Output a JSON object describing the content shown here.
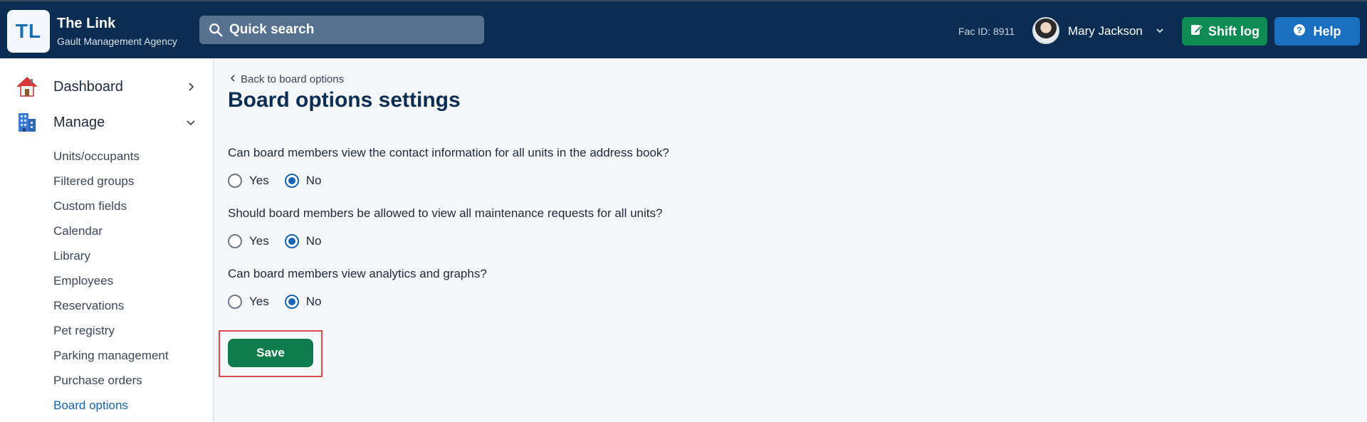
{
  "header": {
    "logo_text": "TL",
    "app_title": "The Link",
    "app_subtitle": "Gault Management Agency",
    "search_placeholder": "Quick search",
    "fac_id": "Fac ID: 8911",
    "user_name": "Mary Jackson",
    "shift_log_label": "Shift log",
    "help_label": "Help",
    "colors": {
      "bg": "#0b2d52",
      "shift": "#0e8a53",
      "help": "#1a6fc0"
    }
  },
  "sidebar": {
    "dashboard_label": "Dashboard",
    "manage_label": "Manage",
    "items": [
      {
        "label": "Units/occupants"
      },
      {
        "label": "Filtered groups"
      },
      {
        "label": "Custom fields"
      },
      {
        "label": "Calendar"
      },
      {
        "label": "Library"
      },
      {
        "label": "Employees"
      },
      {
        "label": "Reservations"
      },
      {
        "label": "Pet registry"
      },
      {
        "label": "Parking management"
      },
      {
        "label": "Purchase orders"
      },
      {
        "label": "Board options",
        "active": true
      }
    ]
  },
  "main": {
    "back_label": "Back to board options",
    "title": "Board options settings",
    "yes_label": "Yes",
    "no_label": "No",
    "questions": [
      {
        "text": "Can board members view the contact information for all units in the address book?",
        "selected": "No"
      },
      {
        "text": "Should board members be allowed to view all maintenance requests for all units?",
        "selected": "No"
      },
      {
        "text": "Can board members view analytics and graphs?",
        "selected": "No"
      }
    ],
    "save_label": "Save"
  }
}
